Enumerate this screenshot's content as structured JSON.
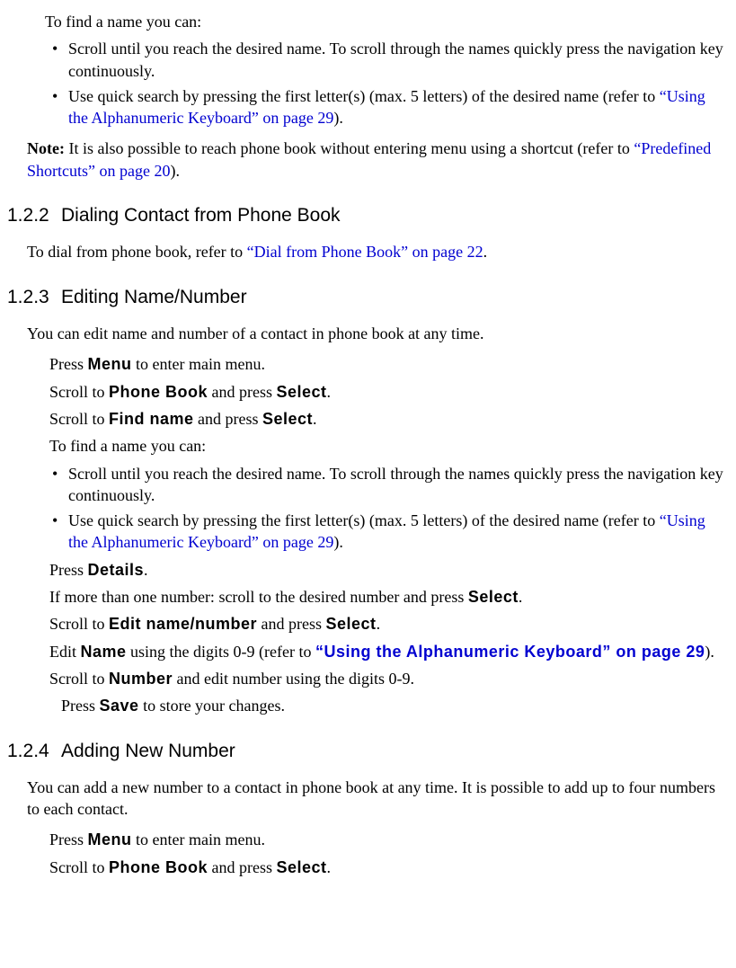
{
  "intro": {
    "find_name_intro": "To find a name you can:",
    "bullet1": "Scroll until you reach the desired name. To scroll through the names quickly press the navigation key continuously.",
    "bullet2_a": "Use quick search by pressing the first letter(s) (max. 5 letters) of the desired name (refer to ",
    "bullet2_link": "“Using the Alphanumeric Keyboard” on page 29",
    "bullet2_b": ").",
    "note_label": "Note:",
    "note_body_a": " It is also possible to reach phone book without entering menu using a shortcut (refer to ",
    "note_link": "“Predefined Shortcuts” on page 20",
    "note_body_b": ")."
  },
  "s122": {
    "num": "1.2.2",
    "title": "Dialing Contact from Phone Book",
    "body_a": "To dial from phone book, refer to ",
    "body_link": "“Dial from Phone Book” on page 22",
    "body_b": "."
  },
  "s123": {
    "num": "1.2.3",
    "title": "Editing Name/Number",
    "intro": "You can edit name and number of a contact in phone book at any time.",
    "step1_a": "Press ",
    "step1_key": "Menu",
    "step1_b": " to enter main menu.",
    "step2_a": "Scroll to ",
    "step2_key1": "Phone Book",
    "step2_b": " and press ",
    "step2_key2": "Select",
    "step2_c": ".",
    "step3_a": "Scroll to ",
    "step3_key1": "Find name",
    "step3_b": " and press ",
    "step3_key2": "Select",
    "step3_c": ".",
    "find_name_intro": "To find a name you can:",
    "bullet1": "Scroll until you reach the desired name. To scroll through the names quickly press the navigation key continuously.",
    "bullet2_a": "Use quick search by pressing the first letter(s) (max. 5 letters) of the desired name (refer to ",
    "bullet2_link": "“Using the Alphanumeric Keyboard” on page 29",
    "bullet2_b": ").",
    "step4_a": "Press ",
    "step4_key": "Details",
    "step4_b": ".",
    "step5_a": "If more than one number: scroll to the desired number and press ",
    "step5_key": "Select",
    "step5_b": ".",
    "step6_a": "Scroll to ",
    "step6_key1": "Edit name/number",
    "step6_b": " and press ",
    "step6_key2": "Select",
    "step6_c": ".",
    "step7_a": "Edit ",
    "step7_key": "Name",
    "step7_b": " using the digits 0-9 (refer to ",
    "step7_link": "“Using the Alphanumeric Keyboard” on page 29",
    "step7_c": ").",
    "step8_a": "Scroll to ",
    "step8_key": "Number",
    "step8_b": " and edit number using the digits 0-9.",
    "step9_a": "Press ",
    "step9_key": "Save",
    "step9_b": " to store your changes."
  },
  "s124": {
    "num": "1.2.4",
    "title": "Adding New Number",
    "intro": "You can add a new number to a contact in phone book at any time. It is possible to add up to four numbers to each contact.",
    "step1_a": "Press ",
    "step1_key": "Menu",
    "step1_b": " to enter main menu.",
    "step2_a": "Scroll to ",
    "step2_key1": "Phone Book",
    "step2_b": " and press ",
    "step2_key2": "Select",
    "step2_c": "."
  }
}
